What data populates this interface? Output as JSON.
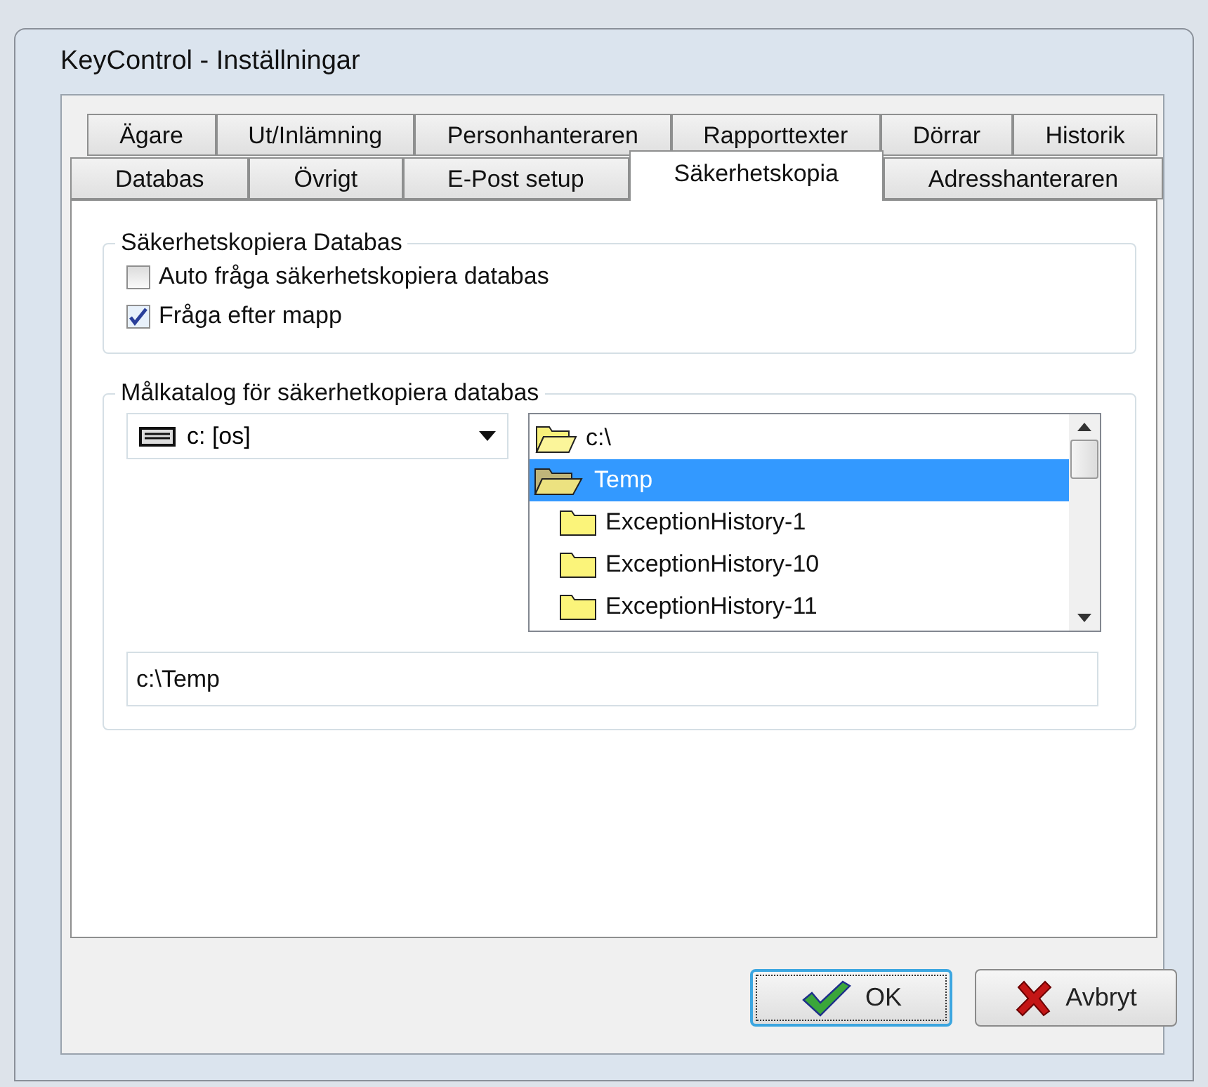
{
  "window": {
    "title": "KeyControl - Inställningar"
  },
  "tab_rows": [
    [
      {
        "label": "Ägare",
        "selected": false
      },
      {
        "label": "Ut/Inlämning",
        "selected": false
      },
      {
        "label": "Personhanteraren",
        "selected": false
      },
      {
        "label": "Rapporttexter",
        "selected": false
      },
      {
        "label": "Dörrar",
        "selected": false
      },
      {
        "label": "Historik",
        "selected": false
      }
    ],
    [
      {
        "label": "Databas",
        "selected": false
      },
      {
        "label": "Övrigt",
        "selected": false
      },
      {
        "label": "E-Post setup",
        "selected": false
      },
      {
        "label": "Säkerhetskopia",
        "selected": true
      },
      {
        "label": "Adresshanteraren",
        "selected": false
      }
    ]
  ],
  "backup_group": {
    "title": "Säkerhetskopiera Databas",
    "options": [
      {
        "label": "Auto fråga säkerhetskopiera databas",
        "checked": false
      },
      {
        "label": "Fråga efter mapp",
        "checked": true
      }
    ]
  },
  "target_group": {
    "title": "Målkatalog för säkerhetkopiera databas",
    "drive": {
      "value": "c: [os]"
    },
    "folders": [
      {
        "name": "c:\\",
        "kind": "open",
        "selected": false
      },
      {
        "name": "Temp",
        "kind": "current",
        "selected": true
      },
      {
        "name": "ExceptionHistory-1",
        "kind": "closed",
        "selected": false
      },
      {
        "name": "ExceptionHistory-10",
        "kind": "closed",
        "selected": false
      },
      {
        "name": "ExceptionHistory-11",
        "kind": "closed",
        "selected": false
      }
    ],
    "path": {
      "value": "c:\\Temp"
    }
  },
  "buttons": [
    {
      "label": "OK",
      "kind": "ok",
      "focused": true
    },
    {
      "label": "Avbryt",
      "kind": "cancel",
      "focused": false
    }
  ]
}
